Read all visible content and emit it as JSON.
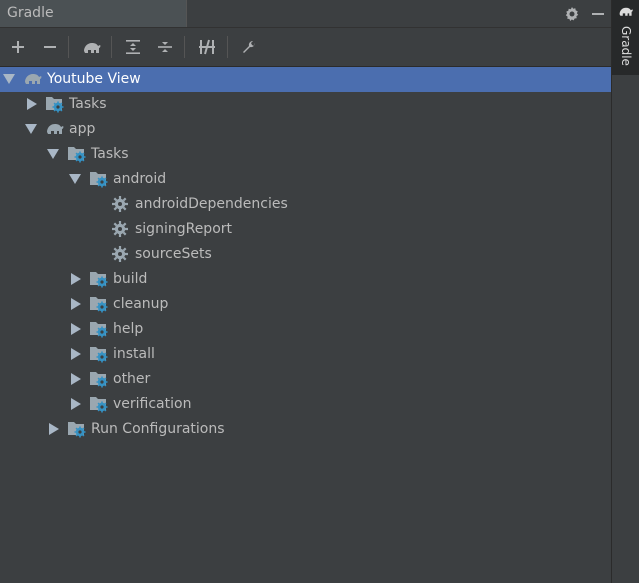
{
  "window": {
    "title": "Gradle"
  },
  "side_tab": {
    "label": "Gradle"
  },
  "toolbar": {
    "buttons": [
      "plus-icon",
      "minus-icon",
      "elephant-icon",
      "expand-all-icon",
      "collapse-all-icon",
      "toggle-offline-icon",
      "wrench-icon"
    ]
  },
  "tree": [
    {
      "label": "Youtube View",
      "depth": 0,
      "state": "expanded",
      "icon": "elephant-icon",
      "selected": true
    },
    {
      "label": "Tasks",
      "depth": 1,
      "state": "collapsed",
      "icon": "folder-gear-icon"
    },
    {
      "label": "app",
      "depth": 1,
      "state": "expanded",
      "icon": "elephant-icon"
    },
    {
      "label": "Tasks",
      "depth": 2,
      "state": "expanded",
      "icon": "folder-gear-icon"
    },
    {
      "label": "android",
      "depth": 3,
      "state": "expanded",
      "icon": "folder-gear-icon"
    },
    {
      "label": "androidDependencies",
      "depth": 4,
      "state": "leaf",
      "icon": "gear-icon"
    },
    {
      "label": "signingReport",
      "depth": 4,
      "state": "leaf",
      "icon": "gear-icon"
    },
    {
      "label": "sourceSets",
      "depth": 4,
      "state": "leaf",
      "icon": "gear-icon"
    },
    {
      "label": "build",
      "depth": 3,
      "state": "collapsed",
      "icon": "folder-gear-icon"
    },
    {
      "label": "cleanup",
      "depth": 3,
      "state": "collapsed",
      "icon": "folder-gear-icon"
    },
    {
      "label": "help",
      "depth": 3,
      "state": "collapsed",
      "icon": "folder-gear-icon"
    },
    {
      "label": "install",
      "depth": 3,
      "state": "collapsed",
      "icon": "folder-gear-icon"
    },
    {
      "label": "other",
      "depth": 3,
      "state": "collapsed",
      "icon": "folder-gear-icon"
    },
    {
      "label": "verification",
      "depth": 3,
      "state": "collapsed",
      "icon": "folder-gear-icon"
    },
    {
      "label": "Run Configurations",
      "depth": 2,
      "state": "collapsed",
      "icon": "folder-gear-icon"
    }
  ],
  "colors": {
    "background": "#3c3f41",
    "selection": "#4b6eaf",
    "text": "#bbbbbb",
    "gear_accent": "#3592c4"
  }
}
